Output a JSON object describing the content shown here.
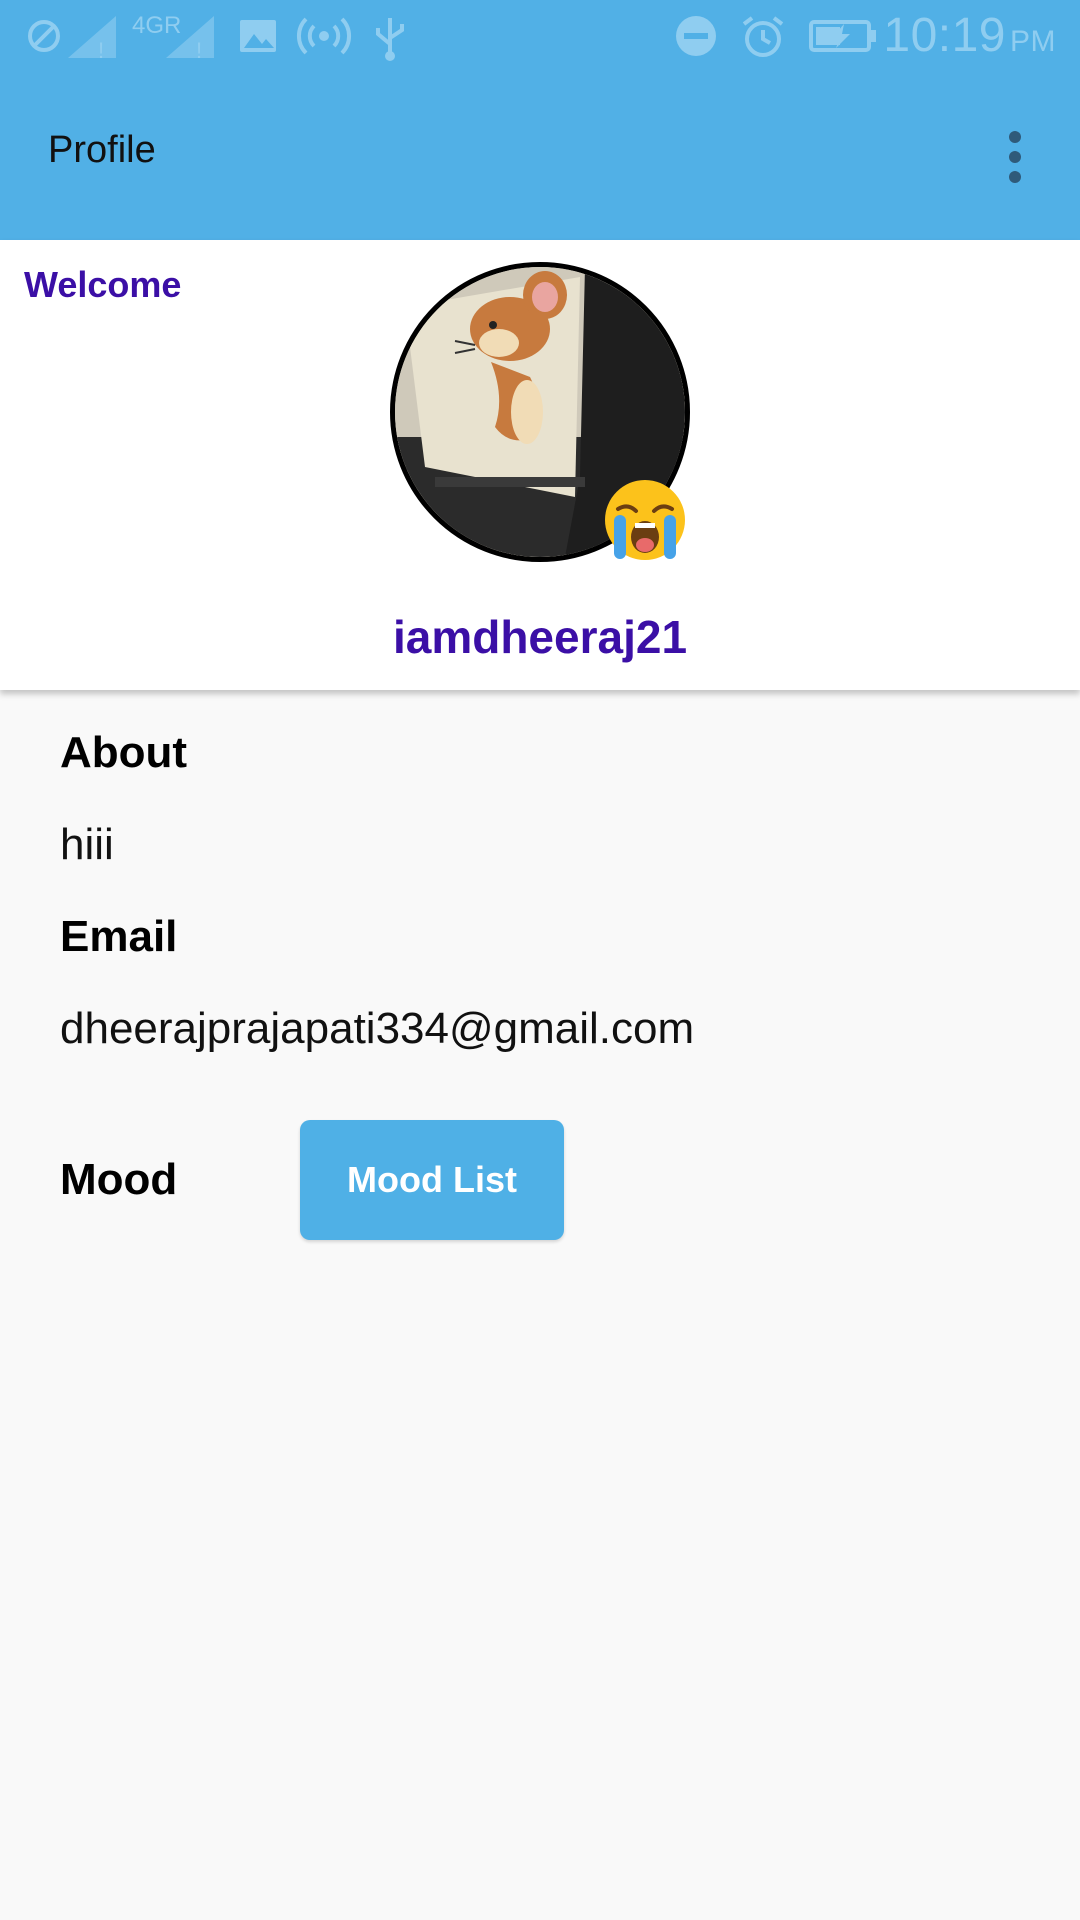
{
  "status_bar": {
    "network_label": "4GR",
    "time": "10:19",
    "ampm": "PM",
    "icons": [
      "block-icon",
      "signal-sim1-icon",
      "signal-sim2-icon",
      "image-icon",
      "hotspot-icon",
      "usb-icon",
      "do-not-disturb-icon",
      "alarm-icon",
      "battery-charging-icon"
    ]
  },
  "app_bar": {
    "title": "Profile",
    "menu_icon": "more-vert-icon"
  },
  "header": {
    "welcome": "Welcome",
    "username": "iamdheeraj21",
    "mood_emoji": "loudly-crying-face"
  },
  "profile": {
    "about_label": "About",
    "about_value": "hiii",
    "email_label": "Email",
    "email_value": "dheerajprajapati334@gmail.com",
    "mood_label": "Mood",
    "mood_button": "Mood List"
  },
  "colors": {
    "primary": "#51b0e6",
    "accent_text": "#3b0fa6",
    "background": "#f9f9f9"
  }
}
